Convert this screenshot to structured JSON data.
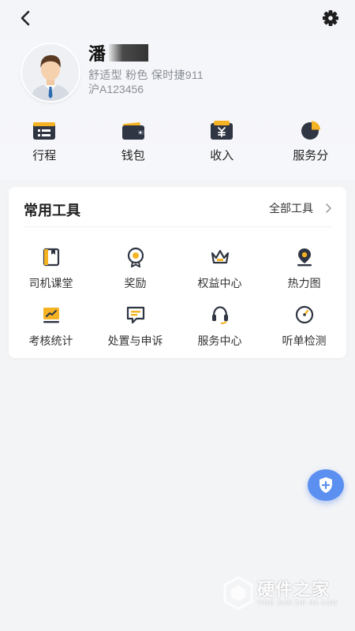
{
  "header": {
    "back_icon": "chevron-left-icon",
    "settings_icon": "gear-icon"
  },
  "profile": {
    "name": "潘",
    "car_info": "舒适型 粉色 保时捷911",
    "plate": "沪A123456",
    "avatar_icon": "driver-avatar"
  },
  "quick_actions": [
    {
      "label": "行程",
      "icon": "trip-list-icon"
    },
    {
      "label": "钱包",
      "icon": "wallet-icon"
    },
    {
      "label": "收入",
      "icon": "income-icon"
    },
    {
      "label": "服务分",
      "icon": "service-score-icon"
    }
  ],
  "tools": {
    "title": "常用工具",
    "all_label": "全部工具",
    "items": [
      {
        "label": "司机课堂",
        "icon": "book-icon"
      },
      {
        "label": "奖励",
        "icon": "medal-icon"
      },
      {
        "label": "权益中心",
        "icon": "crown-icon"
      },
      {
        "label": "热力图",
        "icon": "map-pin-icon"
      },
      {
        "label": "考核统计",
        "icon": "chart-icon"
      },
      {
        "label": "处置与申诉",
        "icon": "message-icon"
      },
      {
        "label": "服务中心",
        "icon": "headset-icon"
      },
      {
        "label": "听单检测",
        "icon": "gauge-icon"
      }
    ]
  },
  "fab": {
    "icon": "shield-plus-icon"
  },
  "watermark": {
    "title": "硬件之家",
    "subtitle": "YING JIAN ZHI JIA.COM"
  },
  "colors": {
    "dark": "#2f3542",
    "accent": "#f5b324",
    "fab": "#5b8ff0",
    "background": "#f3f4f6"
  }
}
